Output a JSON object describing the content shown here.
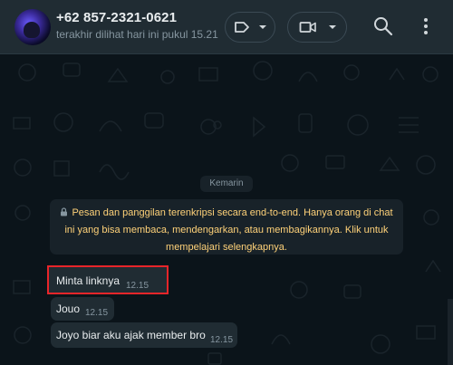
{
  "header": {
    "contact_name": "+62 857-2321-0621",
    "last_seen": "terakhir dilihat hari ini pukul 15.21",
    "icons": {
      "label": "label-icon",
      "video": "video-call-icon",
      "caret": "chevron-down-icon",
      "search": "search-icon",
      "menu": "more-options-icon"
    }
  },
  "chat": {
    "day_separator": "Kemarin",
    "encryption_notice": "Pesan dan panggilan terenkripsi secara end-to-end. Hanya orang di chat ini yang bisa membaca, mendengarkan, atau membagikannya. Klik untuk mempelajari selengkapnya.",
    "messages": [
      {
        "text": "Minta linknya",
        "time": "12.15",
        "highlighted": true
      },
      {
        "text": "Jouo",
        "time": "12.15",
        "highlighted": false
      },
      {
        "text": "Joyo biar aku ajak member bro",
        "time": "12.15",
        "highlighted": false
      }
    ]
  },
  "colors": {
    "background": "#0b141a",
    "header": "#202c33",
    "bubble": "#202c33",
    "encryption_text": "#ffd279",
    "secondary_text": "#8696a0",
    "highlight_box": "#e8252a"
  }
}
